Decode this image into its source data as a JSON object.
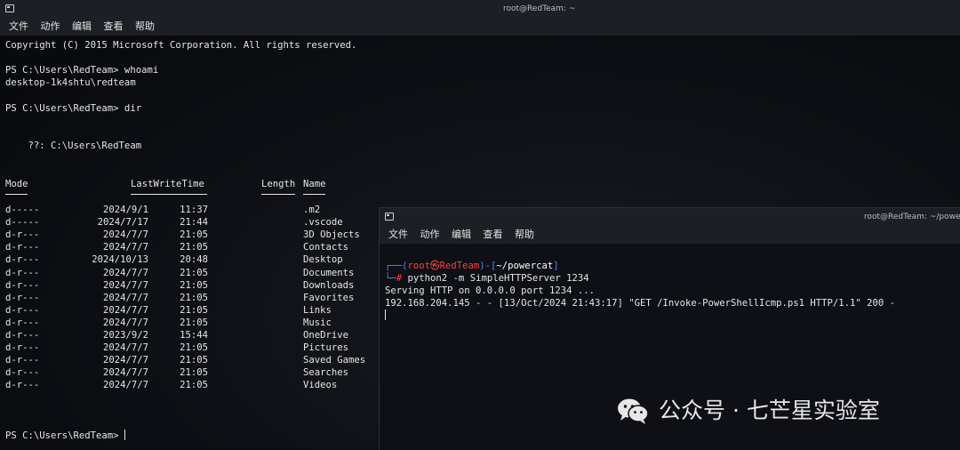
{
  "back_window": {
    "title": "root@RedTeam: ~",
    "menu": [
      "文件",
      "动作",
      "编辑",
      "查看",
      "帮助"
    ],
    "copyright": "Copyright (C) 2015 Microsoft Corporation. All rights reserved.",
    "prompt1": "PS C:\\Users\\RedTeam> whoami",
    "whoami_output": "desktop-1k4shtu\\redteam",
    "prompt2": "PS C:\\Users\\RedTeam> dir",
    "directory_label": "    ??: C:\\Users\\RedTeam",
    "headers": {
      "mode": "Mode",
      "lastwrite": "LastWriteTime",
      "length": "Length",
      "name": "Name"
    },
    "rows": [
      {
        "mode": "d-----",
        "date": "2024/9/1",
        "time": "11:37",
        "name": ".m2"
      },
      {
        "mode": "d-----",
        "date": "2024/7/17",
        "time": "21:44",
        "name": ".vscode"
      },
      {
        "mode": "d-r---",
        "date": "2024/7/7",
        "time": "21:05",
        "name": "3D Objects"
      },
      {
        "mode": "d-r---",
        "date": "2024/7/7",
        "time": "21:05",
        "name": "Contacts"
      },
      {
        "mode": "d-r---",
        "date": "2024/10/13",
        "time": "20:48",
        "name": "Desktop"
      },
      {
        "mode": "d-r---",
        "date": "2024/7/7",
        "time": "21:05",
        "name": "Documents"
      },
      {
        "mode": "d-r---",
        "date": "2024/7/7",
        "time": "21:05",
        "name": "Downloads"
      },
      {
        "mode": "d-r---",
        "date": "2024/7/7",
        "time": "21:05",
        "name": "Favorites"
      },
      {
        "mode": "d-r---",
        "date": "2024/7/7",
        "time": "21:05",
        "name": "Links"
      },
      {
        "mode": "d-r---",
        "date": "2024/7/7",
        "time": "21:05",
        "name": "Music"
      },
      {
        "mode": "d-r---",
        "date": "2023/9/2",
        "time": "15:44",
        "name": "OneDrive"
      },
      {
        "mode": "d-r---",
        "date": "2024/7/7",
        "time": "21:05",
        "name": "Pictures"
      },
      {
        "mode": "d-r---",
        "date": "2024/7/7",
        "time": "21:05",
        "name": "Saved Games"
      },
      {
        "mode": "d-r---",
        "date": "2024/7/7",
        "time": "21:05",
        "name": "Searches"
      },
      {
        "mode": "d-r---",
        "date": "2024/7/7",
        "time": "21:05",
        "name": "Videos"
      }
    ],
    "final_prompt": "PS C:\\Users\\RedTeam> "
  },
  "front_window": {
    "title": "root@RedTeam: ~/powercat",
    "menu": [
      "文件",
      "动作",
      "编辑",
      "查看",
      "帮助"
    ],
    "prompt_frame_top": "┌──(",
    "prompt_user": "root㉿RedTeam",
    "prompt_mid": ")-[",
    "prompt_path": "~/powercat",
    "prompt_end": "]",
    "prompt_frame_bottom": "└─",
    "prompt_hash": "# ",
    "command": "python2 -m SimpleHTTPServer 1234",
    "output1": "Serving HTTP on 0.0.0.0 port 1234 ...",
    "output2": "192.168.204.145 - - [13/Oct/2024 21:43:17] \"GET /Invoke-PowerShellIcmp.ps1 HTTP/1.1\" 200 -"
  },
  "watermark": {
    "text": "公众号 · 七芒星实验室"
  },
  "colors": {
    "accent_user": "#ff3e3e",
    "accent_frame": "#4a8cf0"
  }
}
